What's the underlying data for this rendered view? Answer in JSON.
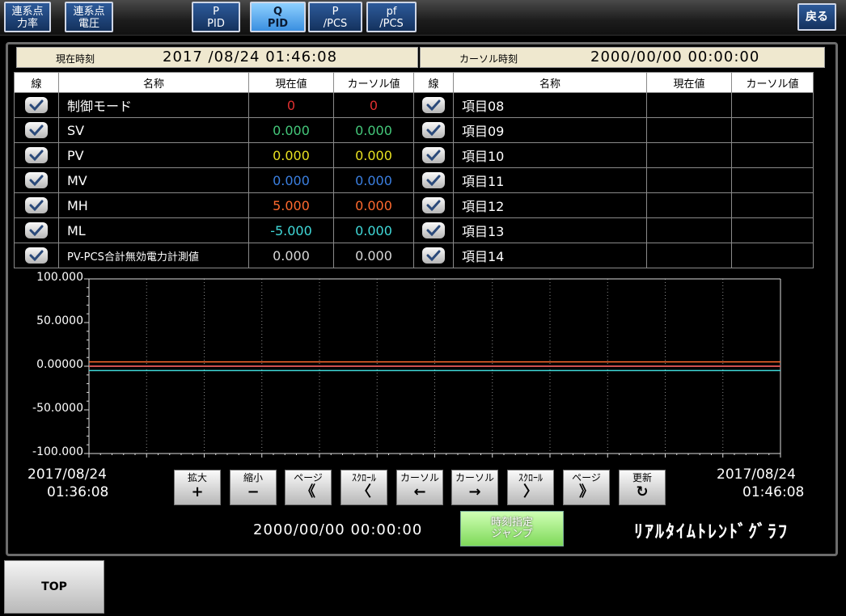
{
  "nav": {
    "buttons": [
      {
        "l1": "連系点",
        "l2": "力率"
      },
      {
        "l1": "連系点",
        "l2": "電圧"
      },
      {
        "l1": "P",
        "l2": "PID"
      },
      {
        "l1": "Q",
        "l2": "PID"
      },
      {
        "l1": "P",
        "l2": "/PCS"
      },
      {
        "l1": "pf",
        "l2": "/PCS"
      }
    ],
    "back": "戻る"
  },
  "timebar": {
    "current_label": "現在時刻",
    "current_value": "2017 /08/24 01:46:08",
    "cursor_label": "カーソル時刻",
    "cursor_value": "2000/00/00 00:00:00"
  },
  "table": {
    "headers": [
      "線",
      "名称",
      "現在値",
      "カーソル値",
      "線",
      "名称",
      "現在値",
      "カーソル値"
    ],
    "left_rows": [
      {
        "name": "制御モード",
        "current": "0",
        "cursor": "0",
        "color": "#e03030"
      },
      {
        "name": "SV",
        "current": "0.000",
        "cursor": "0.000",
        "color": "#44c77a"
      },
      {
        "name": "PV",
        "current": "0.000",
        "cursor": "0.000",
        "color": "#e8e020"
      },
      {
        "name": "MV",
        "current": "0.000",
        "cursor": "0.000",
        "color": "#3b7fe0"
      },
      {
        "name": "MH",
        "current": "5.000",
        "cursor": "0.000",
        "color": "#ff6a2e"
      },
      {
        "name": "ML",
        "current": "-5.000",
        "cursor": "0.000",
        "color": "#40d8d8"
      },
      {
        "name": "PV-PCS合計無効電力計測値",
        "current": "0.000",
        "cursor": "0.000",
        "color": "#d8d8d8"
      }
    ],
    "right_rows": [
      {
        "name": "項目08"
      },
      {
        "name": "項目09"
      },
      {
        "name": "項目10"
      },
      {
        "name": "項目11"
      },
      {
        "name": "項目12"
      },
      {
        "name": "項目13"
      },
      {
        "name": "項目14"
      }
    ]
  },
  "chart_data": {
    "type": "line",
    "ylim": [
      -100,
      100
    ],
    "y_ticks": [
      "100.000",
      "50.0000",
      "0.00000",
      "-50.0000",
      "-100.000"
    ],
    "grid": true,
    "x_start_label": [
      "2017/08/24",
      "01:36:08"
    ],
    "x_end_label": [
      "2017/08/24",
      "01:46:08"
    ],
    "series": [
      {
        "name": "MH",
        "value": 5.0,
        "color": "#ff6a2e"
      },
      {
        "name": "SV",
        "value": 0.0,
        "color": "#44c77a"
      },
      {
        "name": "PV",
        "value": 0.0,
        "color": "#e8e020"
      },
      {
        "name": "MV",
        "value": 0.0,
        "color": "#3b7fe0"
      },
      {
        "name": "PV-PCS合計無効電力計測値",
        "value": 0.0,
        "color": "#d8d8d8"
      },
      {
        "name": "制御モード",
        "value": 0.0,
        "color": "#e03030"
      },
      {
        "name": "ML",
        "value": -5.0,
        "color": "#40d8d8"
      }
    ]
  },
  "controls": [
    {
      "label": "拡大",
      "glyph": "+"
    },
    {
      "label": "縮小",
      "glyph": "−"
    },
    {
      "label": "ページ",
      "glyph": "《"
    },
    {
      "label": "ｽｸﾛｰﾙ",
      "glyph": "〈"
    },
    {
      "label": "カーソル",
      "glyph": "←"
    },
    {
      "label": "カーソル",
      "glyph": "→"
    },
    {
      "label": "ｽｸﾛｰﾙ",
      "glyph": "〉"
    },
    {
      "label": "ページ",
      "glyph": "》"
    },
    {
      "label": "更新",
      "glyph": "↻"
    }
  ],
  "footer": {
    "cursor_time": "2000/00/00 00:00:00",
    "jump_l1": "時刻指定",
    "jump_l2": "ジャンプ",
    "title": "ﾘｱﾙﾀｲﾑﾄﾚﾝﾄﾞｸﾞﾗﾌ"
  },
  "top_button": "TOP"
}
